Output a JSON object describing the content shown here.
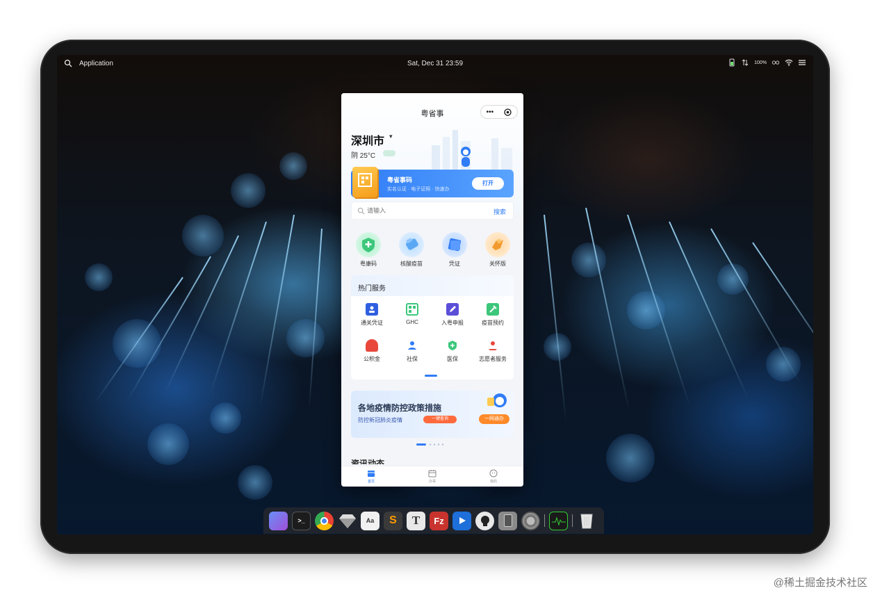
{
  "topbar": {
    "app_label": "Application",
    "datetime": "Sat, Dec 31  23:59",
    "battery": "100%"
  },
  "phone": {
    "title": "粤省事",
    "capsule_more": "•••",
    "city": "深圳市",
    "weather": "阴 25°C",
    "banner": {
      "title": "粤省事码",
      "subtitle": "实名认证 · 电子证照 · 快速办",
      "button": "打开"
    },
    "search": {
      "placeholder": "请输入",
      "button": "搜索"
    },
    "quick": [
      {
        "label": "粤康码"
      },
      {
        "label": "核酸疫苗"
      },
      {
        "label": "凭证"
      },
      {
        "label": "关怀版"
      }
    ],
    "hot": {
      "title": "热门服务",
      "items": [
        {
          "label": "通关凭证"
        },
        {
          "label": "GHC"
        },
        {
          "label": "入粤申报"
        },
        {
          "label": "疫苗预约"
        },
        {
          "label": "公积金"
        },
        {
          "label": "社保"
        },
        {
          "label": "医保"
        },
        {
          "label": "志愿者服务"
        }
      ]
    },
    "promo": {
      "title": "各地疫情防控政策措施",
      "subtitle": "防控新冠肺炎疫情",
      "chip": "一键查询",
      "button": "一网通办"
    },
    "next_section": "资讯动态",
    "tabs": [
      {
        "label": "首页"
      },
      {
        "label": "办事"
      },
      {
        "label": "我的"
      }
    ]
  },
  "dock": {
    "icons": [
      "finder-icon",
      "terminal-icon",
      "chrome-icon",
      "sketch-icon",
      "preview-icon",
      "sublime-icon",
      "typora-icon",
      "filezilla-icon",
      "quicktime-icon",
      "github-icon",
      "remote-icon",
      "system-preferences-icon",
      "activity-monitor-icon",
      "trash-icon"
    ]
  },
  "watermark": "@稀土掘金技术社区"
}
